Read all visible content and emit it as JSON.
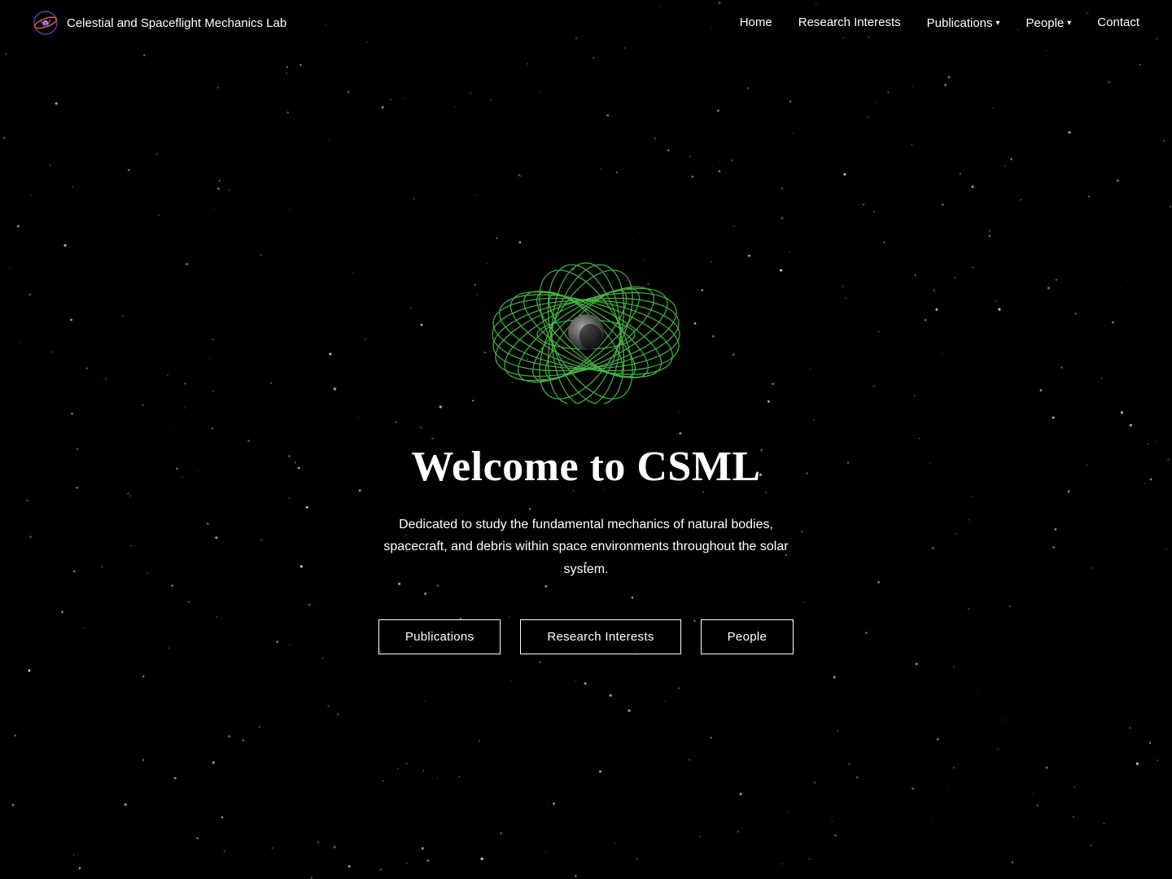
{
  "nav": {
    "brand_name": "Celestial and Spaceflight Mechanics Lab",
    "links": [
      {
        "label": "Home",
        "id": "home",
        "dropdown": false
      },
      {
        "label": "Research Interests",
        "id": "research-interests",
        "dropdown": false
      },
      {
        "label": "Publications",
        "id": "publications",
        "dropdown": true
      },
      {
        "label": "People",
        "id": "people",
        "dropdown": true
      },
      {
        "label": "Contact",
        "id": "contact",
        "dropdown": false
      }
    ]
  },
  "hero": {
    "title": "Welcome to CSML",
    "subtitle": "Dedicated to study the fundamental mechanics of natural bodies, spacecraft, and debris within space environments throughout the solar system.",
    "buttons": [
      {
        "label": "Publications",
        "id": "pub-btn"
      },
      {
        "label": "Research Interests",
        "id": "ri-btn"
      },
      {
        "label": "People",
        "id": "people-btn"
      }
    ]
  },
  "colors": {
    "orbit_green": "#4ec94e",
    "star_bg": "#000000",
    "text_white": "#ffffff"
  }
}
